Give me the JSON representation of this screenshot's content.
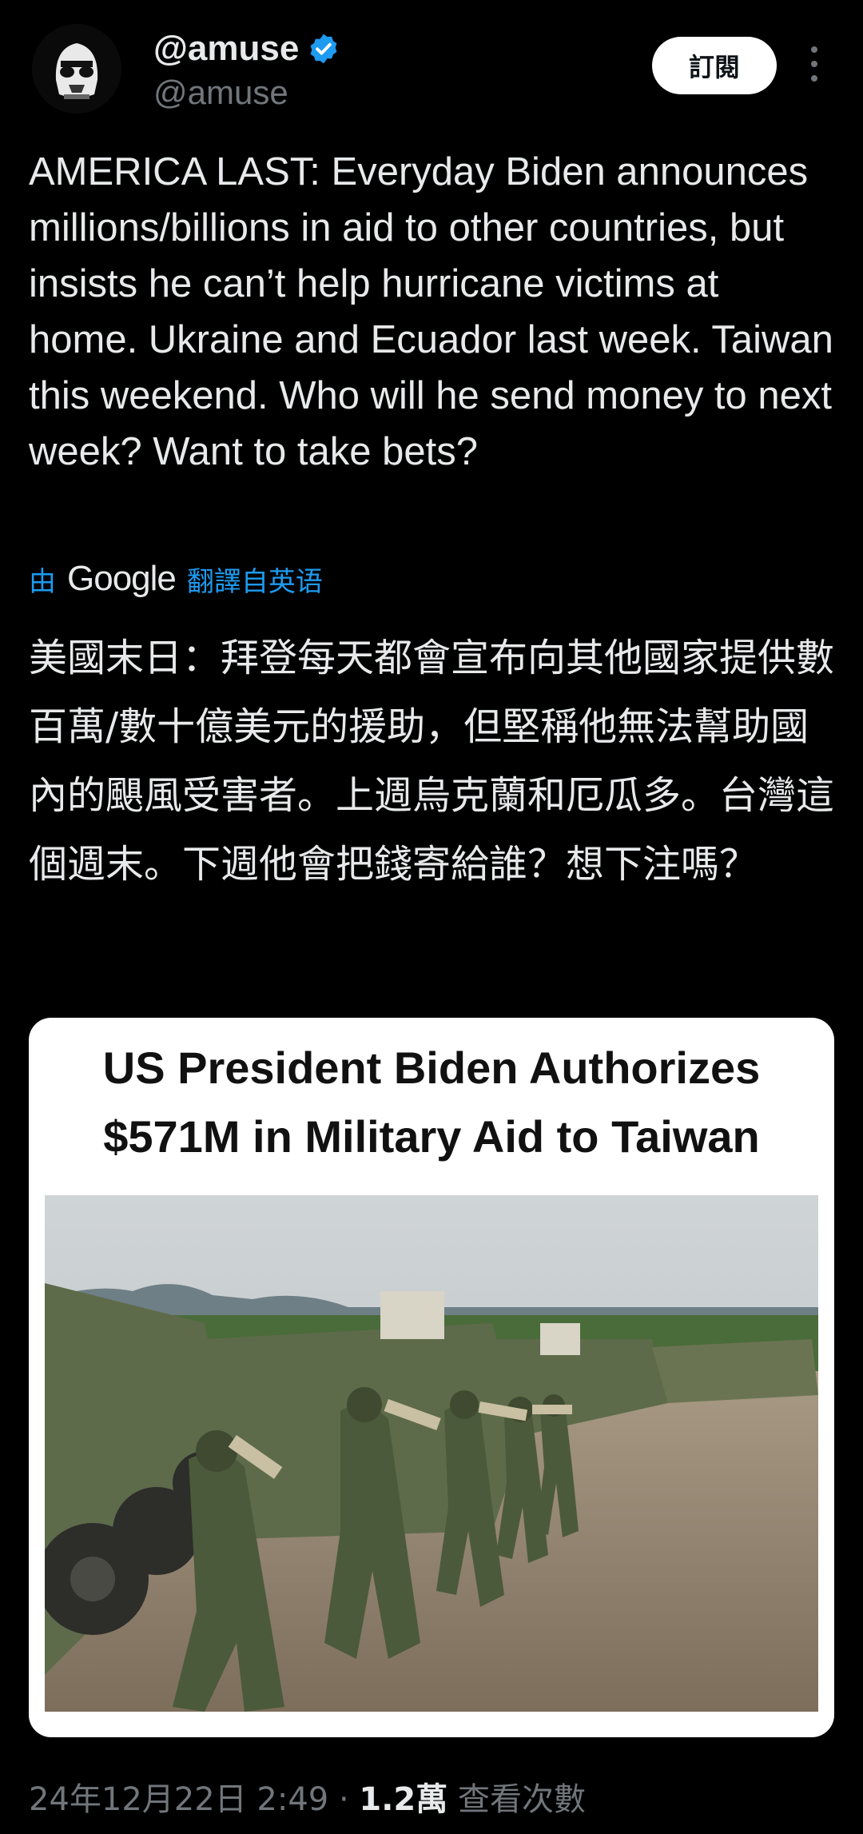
{
  "author": {
    "display_name": "@amuse",
    "handle": "@amuse",
    "subscribe_label": "訂閱"
  },
  "tweet": {
    "text": "AMERICA LAST: Everyday Biden announces millions/billions in aid to other countries, but insists he can’t help hurricane victims at home. Ukraine and Ecuador last week. Taiwan this weekend. Who will he send money to next week? Want to take bets?",
    "translate_prefix": "由",
    "translate_brand": "Google",
    "translate_suffix": "翻譯自英语",
    "translated_text": "美國末日：拜登每天都會宣布向其他國家提供數百萬/數十億美元的援助，但堅稱他無法幫助國內的颶風受害者。上週烏克蘭和厄瓜多。台灣這個週末。下週他會把錢寄給誰？想下注嗎？"
  },
  "media": {
    "headline_line1": "US President Biden Authorizes",
    "headline_line2": "$571M in Military Aid to Taiwan"
  },
  "meta": {
    "timestamp": "24年12月22日 2:49 · ",
    "views_count": "1.2萬",
    "views_label": " 查看次數"
  },
  "colors": {
    "accent": "#1d9bf0",
    "muted": "#71767b",
    "background": "#000000"
  }
}
